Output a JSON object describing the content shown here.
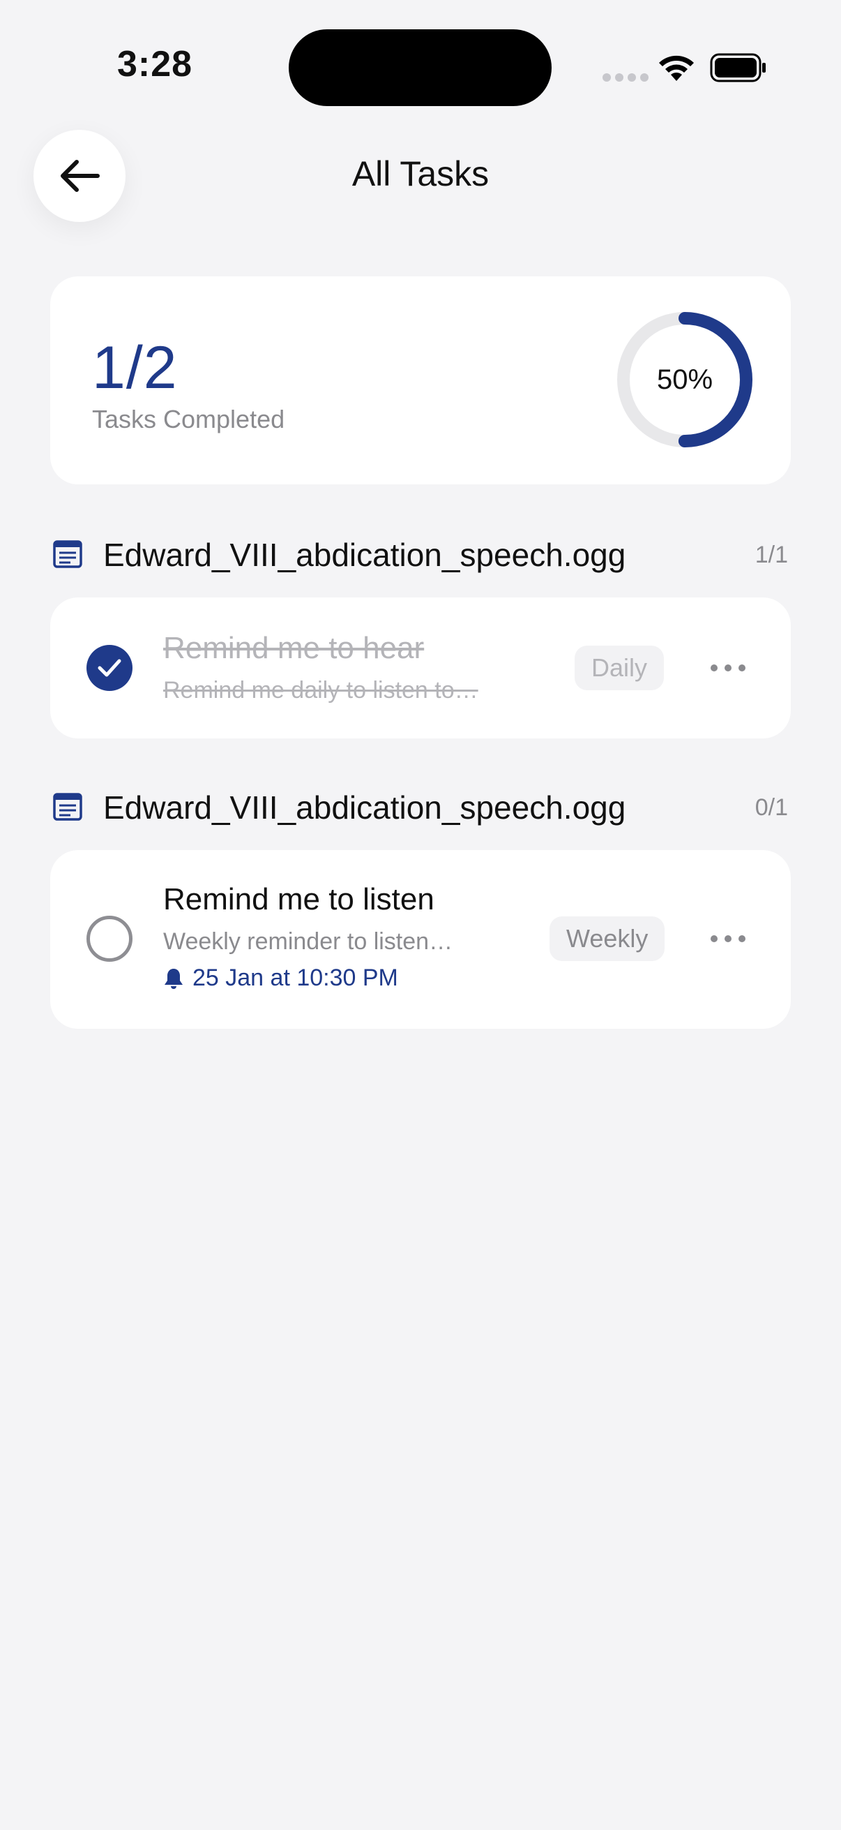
{
  "status_bar": {
    "time": "3:28"
  },
  "header": {
    "title": "All Tasks",
    "back_icon": "arrow-left-icon"
  },
  "summary": {
    "count": "1/2",
    "label": "Tasks Completed",
    "percent_text": "50%",
    "percent_value": 50,
    "ring_color": "#1f3a8a",
    "track_color": "#e8e8ea"
  },
  "groups": [
    {
      "title": "Edward_VIII_abdication_speech.ogg",
      "count": "1/1",
      "icon": "document-icon",
      "tasks": [
        {
          "title": "Remind me to hear",
          "description": "Remind me daily to listen to…",
          "frequency": "Daily",
          "completed": true
        }
      ]
    },
    {
      "title": "Edward_VIII_abdication_speech.ogg",
      "count": "0/1",
      "icon": "document-icon",
      "tasks": [
        {
          "title": "Remind me to listen",
          "description": "Weekly reminder to listen…",
          "reminder": "25 Jan at 10:30 PM",
          "frequency": "Weekly",
          "completed": false
        }
      ]
    }
  ],
  "colors": {
    "accent": "#1f3a8a",
    "background": "#f4f4f6",
    "card": "#ffffff",
    "muted_text": "#8a8a8e"
  }
}
